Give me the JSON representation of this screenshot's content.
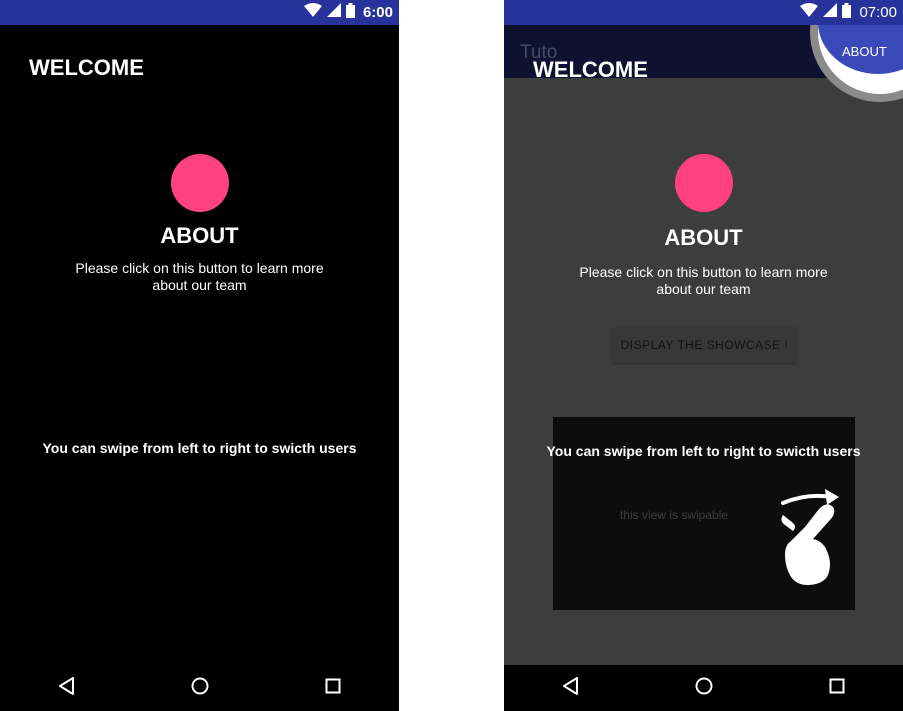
{
  "left": {
    "status": {
      "time": "6:00"
    },
    "welcome": "WELCOME",
    "about": {
      "title": "ABOUT",
      "description": "Please click on this button to learn more about our team"
    },
    "swipe_text": "You can swipe from left to right to swicth users"
  },
  "right": {
    "status": {
      "time": "07:00"
    },
    "app_title": "Tuto",
    "action_about": "ABOUT",
    "welcome": "WELCOME",
    "about": {
      "title": "ABOUT",
      "description": "Please click on this button to learn more about our team"
    },
    "showcase_button": "DISPLAY THE SHOWCASE !",
    "swipe_text": "You can swipe from left to right to swicth users",
    "swipe_hint": "this view is swipable"
  },
  "colors": {
    "status_bar": "#27339a",
    "accent_dot": "#ff4081",
    "action_bar_highlight": "#3a49b8"
  },
  "icons": {
    "status": [
      "wifi-icon",
      "signal-icon",
      "battery-icon"
    ],
    "nav": [
      "back-icon",
      "home-icon",
      "recents-icon"
    ],
    "gesture": "swipe-hand-icon"
  }
}
